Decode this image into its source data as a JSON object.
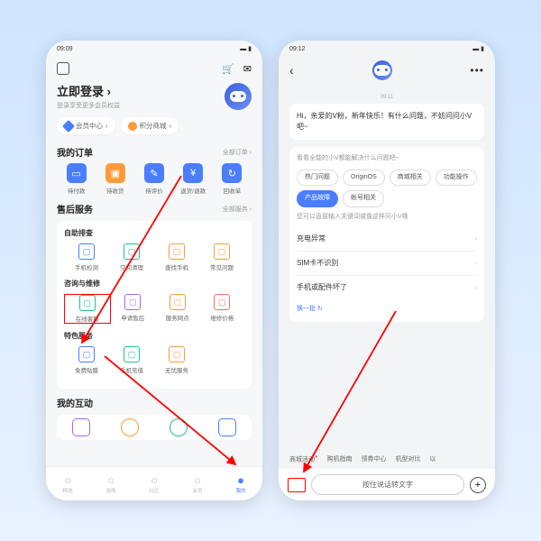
{
  "left": {
    "statusbar": {
      "time": "09:09"
    },
    "login": {
      "title": "立即登录",
      "sub": "登录享受更多会员权益"
    },
    "pills": {
      "member": "会员中心",
      "points": "积分商城"
    },
    "orders": {
      "title": "我的订单",
      "more": "全部订单 ›",
      "items": [
        {
          "label": "待付款",
          "color": "#4a7eff",
          "glyph": "▭"
        },
        {
          "label": "待收货",
          "color": "#ff9a3c",
          "glyph": "▣"
        },
        {
          "label": "待评价",
          "color": "#4a7eff",
          "glyph": "✎"
        },
        {
          "label": "退货/退款",
          "color": "#4a7eff",
          "glyph": "¥"
        },
        {
          "label": "回收单",
          "color": "#4a7eff",
          "glyph": "↻"
        }
      ]
    },
    "service": {
      "title": "售后服务",
      "more": "全部服务 ›",
      "self": {
        "title": "自助排查",
        "items": [
          {
            "label": "手机检测",
            "color": "#4a7eff"
          },
          {
            "label": "空间清理",
            "color": "#1cc29a"
          },
          {
            "label": "查找手机",
            "color": "#ff9a3c"
          },
          {
            "label": "常见问题",
            "color": "#ff9a3c"
          }
        ]
      },
      "consult": {
        "title": "咨询与维修",
        "items": [
          {
            "label": "在线客服",
            "color": "#1cc29a"
          },
          {
            "label": "申请售后",
            "color": "#9b6bff"
          },
          {
            "label": "服务网点",
            "color": "#ff9a3c"
          },
          {
            "label": "维修价格",
            "color": "#ff6b6b"
          }
        ]
      },
      "special": {
        "title": "特色服务",
        "items": [
          {
            "label": "免费贴膜",
            "color": "#4a7eff"
          },
          {
            "label": "手机充值",
            "color": "#1cc29a"
          },
          {
            "label": "无忧服务",
            "color": "#ff9a3c"
          }
        ]
      }
    },
    "interact": {
      "title": "我的互动"
    },
    "nav": [
      {
        "label": "精选"
      },
      {
        "label": "选购"
      },
      {
        "label": "社区"
      },
      {
        "label": "会员"
      },
      {
        "label": "我的"
      }
    ]
  },
  "right": {
    "statusbar": {
      "time": "09:12"
    },
    "chat_time": "09:11",
    "greeting": "Hi，亲爱的V粉，新年快乐！有什么问题，不妨问问小V吧~",
    "solve_hint": "看看全能的小V都能解决什么问题吧~",
    "chips": [
      "热门问题",
      "OriginOS",
      "商城相关",
      "功能操作",
      "产品故障",
      "帐号相关"
    ],
    "active_chip": 4,
    "ask_hint": "您可以直接输入关键词或像这样问小V哦",
    "questions": [
      "充电异常",
      "SIM卡不识别",
      "手机或配件坏了"
    ],
    "refresh": "换一批 ↻",
    "suggestions": [
      "商城活动",
      "购机指南",
      "领券中心",
      "机型对比",
      "以"
    ],
    "voice": "按住说话转文字"
  }
}
